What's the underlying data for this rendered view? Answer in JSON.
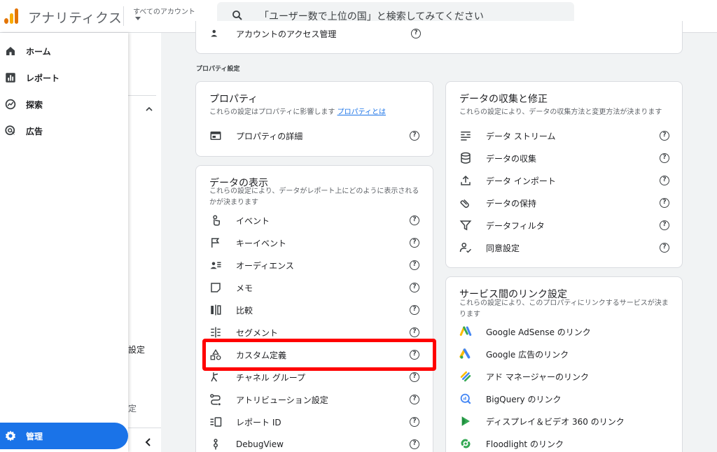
{
  "header": {
    "app_title": "アナリティクス",
    "account_label": "すべてのアカウント",
    "search_placeholder": "「ユーザー数で上位の国」と検索してみてください"
  },
  "sidebar": {
    "items": [
      {
        "label": "ホーム",
        "icon": "home-icon"
      },
      {
        "label": "レポート",
        "icon": "bar-chart-icon"
      },
      {
        "label": "探索",
        "icon": "explore-icon"
      },
      {
        "label": "広告",
        "icon": "ads-icon"
      }
    ],
    "admin_label": "管理"
  },
  "subpane": {
    "fragment1": "設定",
    "fragment2": "定"
  },
  "top_card": {
    "row_label": "アカウントのアクセス管理"
  },
  "section_label": "プロパティ設定",
  "property_card": {
    "title": "プロパティ",
    "subtitle": "これらの設定はプロパティに影響します",
    "link": "プロパティとは",
    "rows": [
      {
        "label": "プロパティの詳細",
        "icon": "property-details-icon"
      }
    ]
  },
  "data_display_card": {
    "title": "データの表示",
    "subtitle_line1": "これらの設定により、データがレポート上にどのように表示される",
    "subtitle_line2": "かが決まります",
    "rows": [
      {
        "label": "イベント",
        "icon": "touch-icon"
      },
      {
        "label": "キーイベント",
        "icon": "flag-icon"
      },
      {
        "label": "オーディエンス",
        "icon": "audience-icon"
      },
      {
        "label": "メモ",
        "icon": "note-icon"
      },
      {
        "label": "比較",
        "icon": "compare-icon"
      },
      {
        "label": "セグメント",
        "icon": "segment-icon"
      },
      {
        "label": "カスタム定義",
        "icon": "shapes-icon"
      },
      {
        "label": "チャネル グループ",
        "icon": "channel-icon"
      },
      {
        "label": "アトリビューション設定",
        "icon": "attribution-icon"
      },
      {
        "label": "レポート ID",
        "icon": "report-id-icon"
      },
      {
        "label": "DebugView",
        "icon": "debug-icon"
      }
    ]
  },
  "data_collection_card": {
    "title": "データの収集と修正",
    "subtitle": "これらの設定により、データの収集方法と変更方法が決まります",
    "rows": [
      {
        "label": "データ ストリーム",
        "icon": "stream-icon"
      },
      {
        "label": "データの収集",
        "icon": "database-icon"
      },
      {
        "label": "データ インポート",
        "icon": "upload-icon"
      },
      {
        "label": "データの保持",
        "icon": "retention-icon"
      },
      {
        "label": "データフィルタ",
        "icon": "filter-icon"
      },
      {
        "label": "同意設定",
        "icon": "consent-icon"
      }
    ]
  },
  "links_card": {
    "title": "サービス間のリンク設定",
    "subtitle_line1": "これらの設定により、このプロパティにリンクするサービスが決ま",
    "subtitle_line2": "ります",
    "rows": [
      {
        "label": "Google AdSense のリンク",
        "icon": "adsense-icon"
      },
      {
        "label": "Google 広告のリンク",
        "icon": "google-ads-icon"
      },
      {
        "label": "アド マネージャーのリンク",
        "icon": "ad-manager-icon"
      },
      {
        "label": "BigQuery のリンク",
        "icon": "bigquery-icon"
      },
      {
        "label": "ディスプレイ＆ビデオ 360 のリンク",
        "icon": "dv360-icon"
      },
      {
        "label": "Floodlight のリンク",
        "icon": "floodlight-icon"
      }
    ]
  },
  "colors": {
    "accent": "#1a73e8",
    "highlight": "#ff0000",
    "logo_orange": "#e37400",
    "logo_yellow": "#f9ab00"
  }
}
